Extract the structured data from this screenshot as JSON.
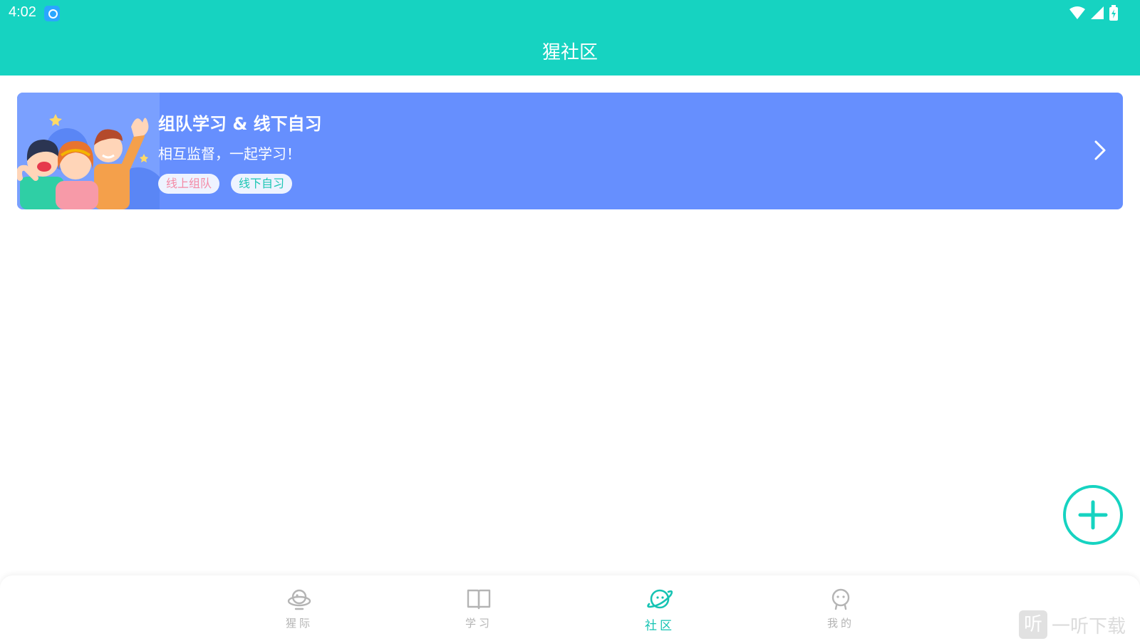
{
  "status_bar": {
    "time": "4:02",
    "app_icon": "app-notification-icon",
    "wifi_icon": "wifi-icon",
    "signal_icon": "cell-signal-icon",
    "battery_icon": "battery-charging-icon"
  },
  "header": {
    "title": "猩社区",
    "background": "#16d3c1"
  },
  "banner": {
    "title": "组队学习 & 线下自习",
    "subtitle": "相互监督，一起学习！",
    "tags": [
      {
        "label": "线上组队",
        "color": "#f48aa5"
      },
      {
        "label": "线下自习",
        "color": "#1cc6b4"
      }
    ],
    "background": "#668ffe",
    "arrow_icon": "chevron-right-icon"
  },
  "fab": {
    "icon": "plus-icon",
    "color": "#16d3c1"
  },
  "bottom_nav": {
    "items": [
      {
        "label": "猩际",
        "icon": "planet-saturn-icon",
        "active": false
      },
      {
        "label": "学习",
        "icon": "open-book-icon",
        "active": false
      },
      {
        "label": "社区",
        "icon": "planet-icon",
        "active": true
      },
      {
        "label": "我的",
        "icon": "face-icon",
        "active": false
      }
    ],
    "active_color": "#16c3b3",
    "inactive_color": "#b4b4b4"
  },
  "watermark": {
    "badge": "听",
    "text": "一听下载"
  }
}
